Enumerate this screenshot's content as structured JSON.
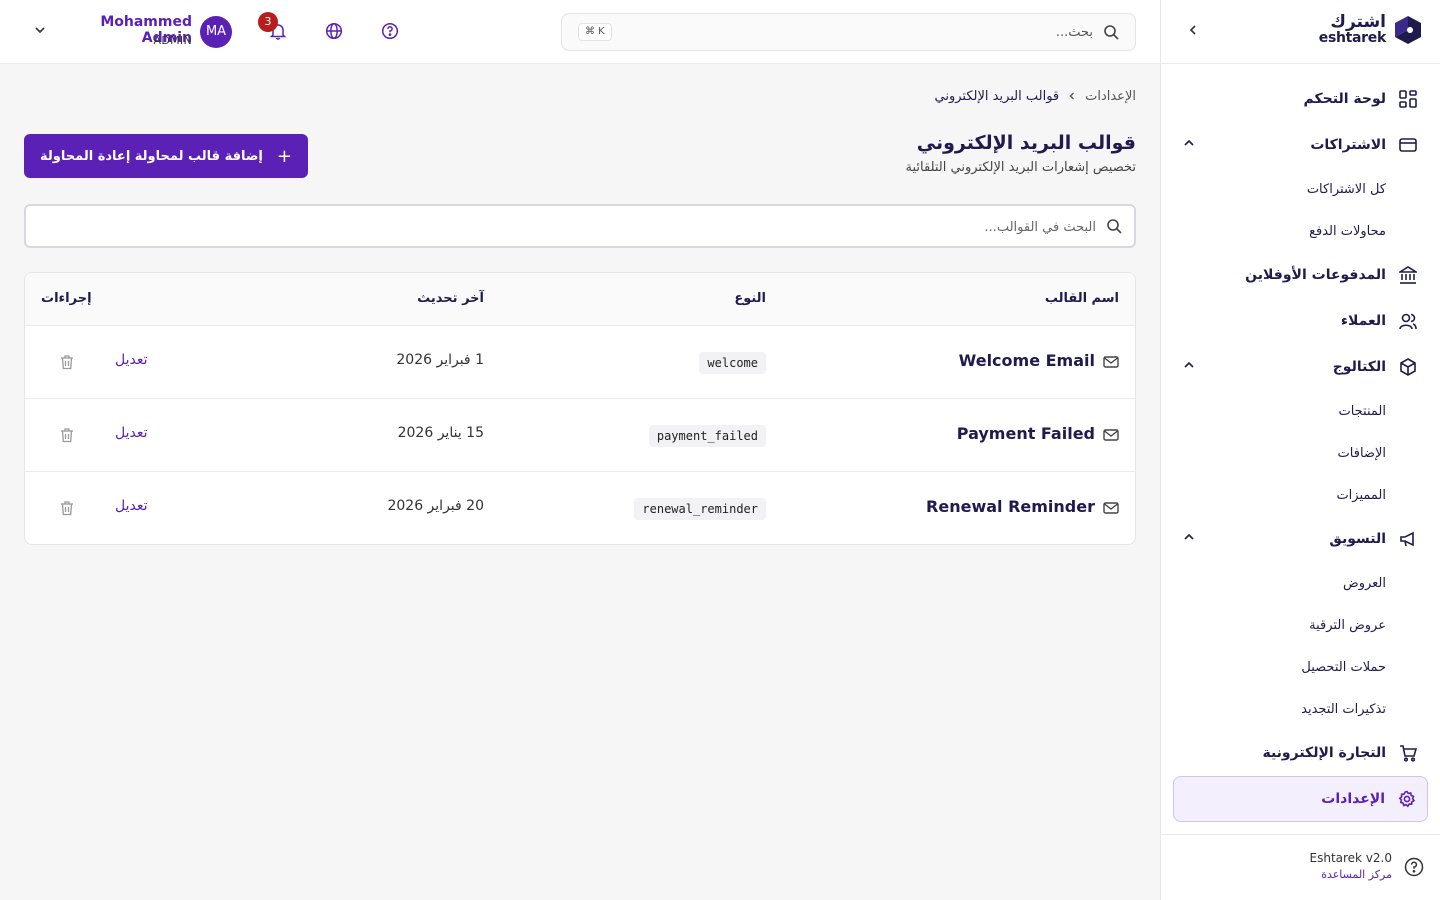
{
  "brand": {
    "name_ar": "اشترك",
    "name_en": "eshtarek"
  },
  "header": {
    "search_placeholder": "بحث...",
    "search_shortcut": "⌘ K",
    "notification_count": "3",
    "user": {
      "initials": "MA",
      "name": "Mohammed Admin",
      "role": "ADMIN"
    }
  },
  "sidebar": {
    "items": [
      {
        "label": "لوحة التحكم",
        "icon": "dashboard-icon"
      },
      {
        "label": "الاشتراكات",
        "icon": "credit-card-icon",
        "expanded": true
      },
      {
        "label": "كل الاشتراكات"
      },
      {
        "label": "محاولات الدفع"
      },
      {
        "label": "المدفوعات الأوفلاين",
        "icon": "bank-icon"
      },
      {
        "label": "العملاء",
        "icon": "users-icon"
      },
      {
        "label": "الكتالوج",
        "icon": "package-icon",
        "expanded": true
      },
      {
        "label": "المنتجات"
      },
      {
        "label": "الإضافات"
      },
      {
        "label": "المميزات"
      },
      {
        "label": "التسويق",
        "icon": "megaphone-icon",
        "expanded": true
      },
      {
        "label": "العروض"
      },
      {
        "label": "عروض الترقية"
      },
      {
        "label": "حملات التحصيل"
      },
      {
        "label": "تذكيرات التجديد"
      },
      {
        "label": "التجارة الإلكترونية",
        "icon": "cart-icon"
      },
      {
        "label": "الإعدادات",
        "icon": "gear-icon",
        "active": true
      }
    ],
    "version": "Eshtarek v2.0",
    "help_center": "مركز المساعدة"
  },
  "breadcrumb": {
    "parent": "الإعدادات",
    "current": "قوالب البريد الإلكتروني"
  },
  "page": {
    "title": "قوالب البريد الإلكتروني",
    "subtitle": "تخصيص إشعارات البريد الإلكتروني التلقائية",
    "add_button": "إضافة قالب لمحاولة إعادة المحاولة",
    "search_placeholder": "البحث في القوالب..."
  },
  "table": {
    "headers": {
      "name": "اسم القالب",
      "type": "النوع",
      "updated": "آخر تحديث",
      "actions": "إجراءات"
    },
    "rows": [
      {
        "name": "Welcome Email",
        "type": "welcome",
        "updated": "1 فبراير 2026",
        "edit": "تعديل"
      },
      {
        "name": "Payment Failed",
        "type": "payment_failed",
        "updated": "15 يناير 2026",
        "edit": "تعديل"
      },
      {
        "name": "Renewal Reminder",
        "type": "renewal_reminder",
        "updated": "20 فبراير 2026",
        "edit": "تعديل"
      }
    ]
  },
  "colors": {
    "brand": "#5b21b6",
    "text": "#1f1b4d",
    "badge": "#b91c1c"
  }
}
